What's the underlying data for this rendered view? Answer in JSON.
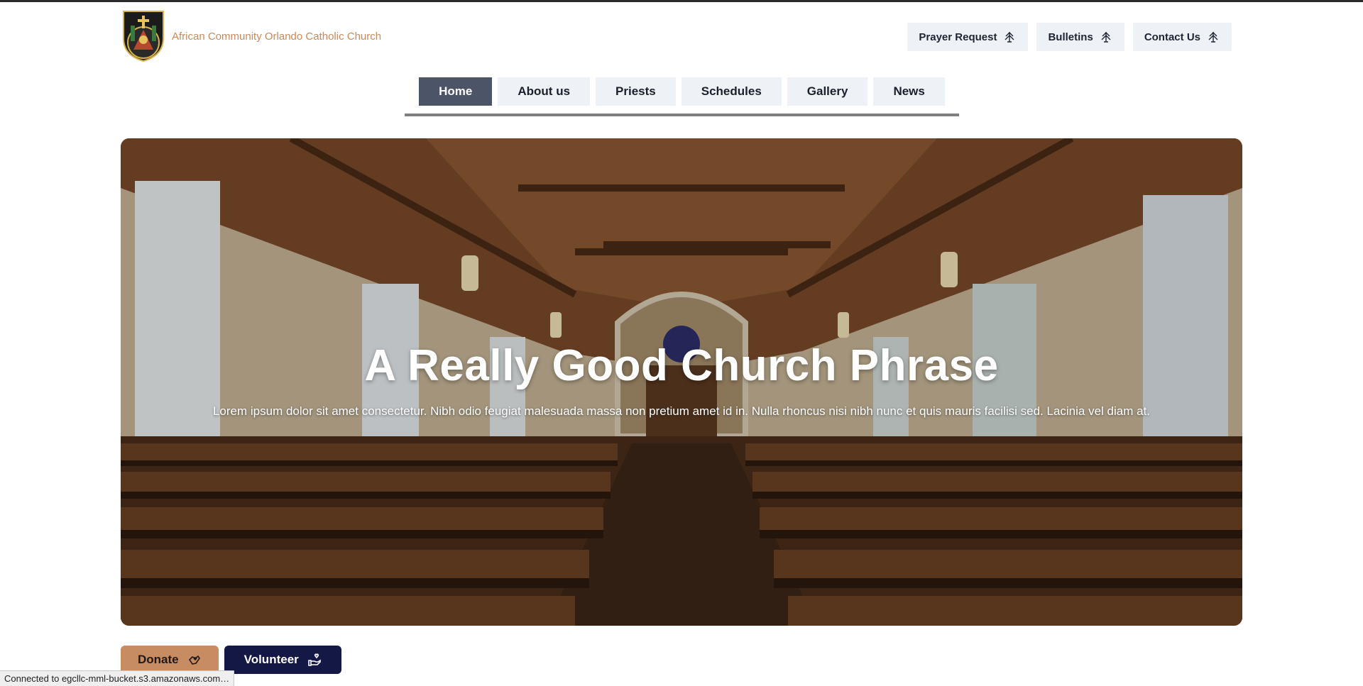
{
  "brand": {
    "name": "African Community Orlando Catholic Church",
    "logo_icon": "church-crest-logo"
  },
  "utility_nav": [
    {
      "label": "Prayer Request",
      "icon": "cross-tree-icon"
    },
    {
      "label": "Bulletins",
      "icon": "cross-tree-icon"
    },
    {
      "label": "Contact Us",
      "icon": "cross-tree-icon"
    }
  ],
  "main_nav": [
    {
      "label": "Home",
      "active": true
    },
    {
      "label": "About us"
    },
    {
      "label": "Priests"
    },
    {
      "label": "Schedules"
    },
    {
      "label": "Gallery"
    },
    {
      "label": "News"
    }
  ],
  "hero": {
    "title": "A Really Good Church Phrase",
    "subtitle": "Lorem ipsum dolor sit amet consectetur. Nibh odio feugiat malesuada massa non pretium amet id in. Nulla rhoncus nisi nibh nunc et quis mauris facilisi sed. Lacinia vel diam at."
  },
  "cta": {
    "donate": {
      "label": "Donate",
      "icon": "hand-heart-icon"
    },
    "volunteer": {
      "label": "Volunteer",
      "icon": "helping-hand-icon"
    }
  },
  "status": "Connected to egcllc-mml-bucket.s3.amazonaws.com…",
  "colors": {
    "accent": "#c88c62",
    "nav_active": "#4c5568",
    "nav_bg": "#eef2f6",
    "volunteer_bg": "#131845",
    "brand_text": "#c98a5a"
  }
}
